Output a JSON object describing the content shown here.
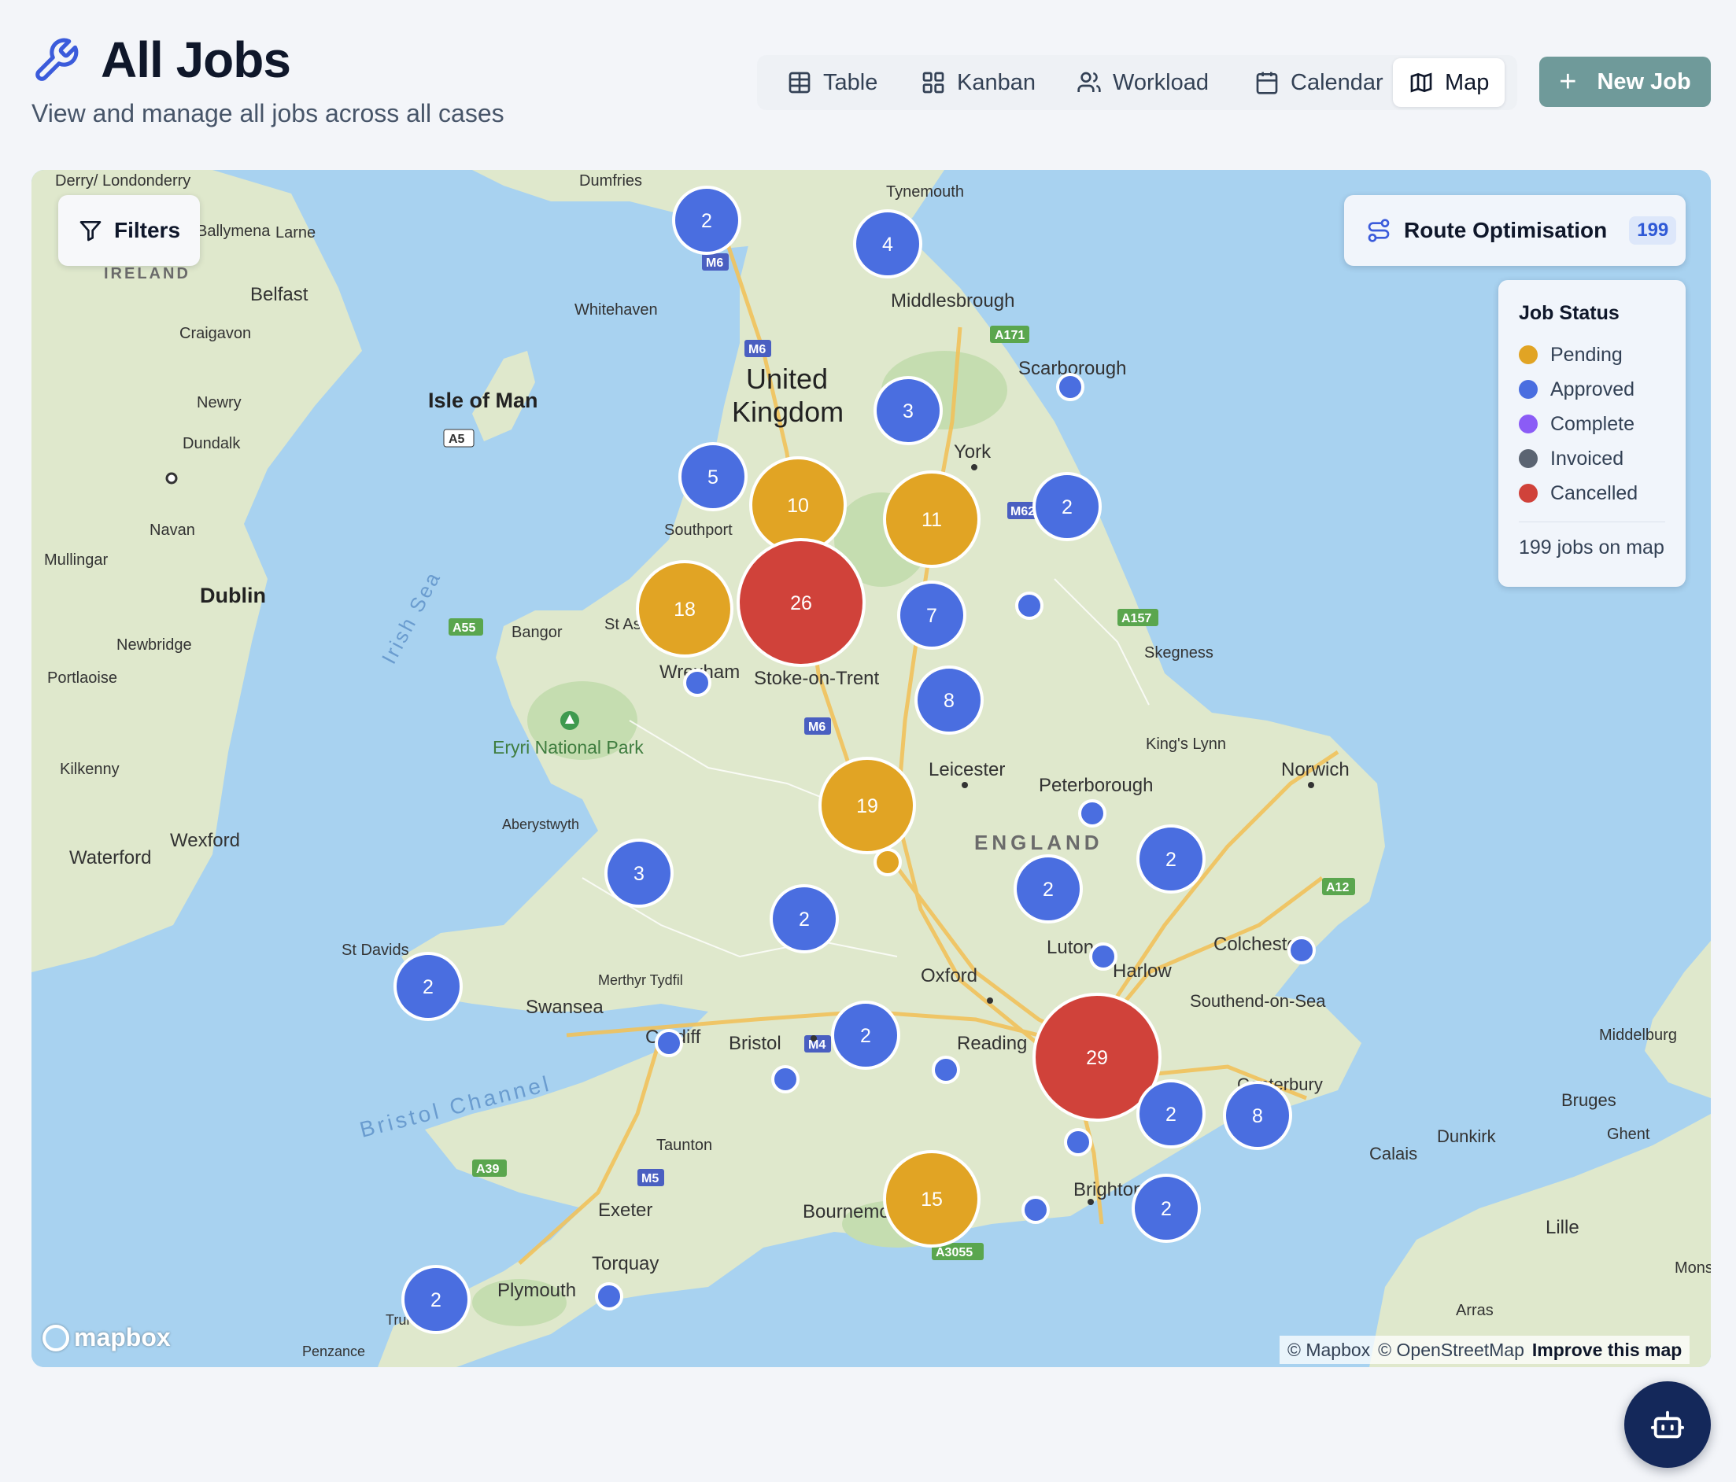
{
  "header": {
    "title": "All Jobs",
    "subtitle": "View and manage all jobs across all cases",
    "icon": "wrench-icon"
  },
  "view_tabs": [
    {
      "label": "Table",
      "icon": "table-icon"
    },
    {
      "label": "Kanban",
      "icon": "kanban-icon"
    },
    {
      "label": "Workload",
      "icon": "users-icon"
    },
    {
      "label": "Calendar",
      "icon": "calendar-icon"
    },
    {
      "label": "Map",
      "icon": "map-icon",
      "active": true
    }
  ],
  "new_job_label": "New Job",
  "map": {
    "filters_label": "Filters",
    "route_label": "Route Optimisation",
    "route_count": "199",
    "legend_title": "Job Status",
    "legend": [
      {
        "label": "Pending",
        "color": "#e1a424"
      },
      {
        "label": "Approved",
        "color": "#4a6ee0"
      },
      {
        "label": "Complete",
        "color": "#8b5cf6"
      },
      {
        "label": "Invoiced",
        "color": "#5b6472"
      },
      {
        "label": "Cancelled",
        "color": "#d0423a"
      }
    ],
    "jobs_on_map": "199 jobs on map",
    "attribution": {
      "mapbox": "© Mapbox",
      "osm": "© OpenStreetMap",
      "improve": "Improve this map"
    },
    "mapbox_logo": "mapbox",
    "place_labels": [
      "Derry/ Londonderry",
      "Dumfries",
      "Tynemouth",
      "Ballymena",
      "Larne",
      "IRELAND",
      "Belfast",
      "Middlesbrough",
      "Whitehaven",
      "Craigavon",
      "Scarborough",
      "United",
      "Kingdom",
      "Isle of Man",
      "Newry",
      "Dundalk",
      "York",
      "Southport",
      "Navan",
      "Mullingar",
      "Dublin",
      "Irish Sea",
      "Bangor",
      "St Asaph",
      "Skegness",
      "Newbridge",
      "Portlaoise",
      "Wrexham",
      "Stoke-on-Trent",
      "Eryri National Park",
      "King's Lynn",
      "Leicester",
      "Norwich",
      "Peterborough",
      "Kilkenny",
      "Aberystwyth",
      "ENGLAND",
      "Wexford",
      "Waterford",
      "Colchester",
      "Luton",
      "St Davids",
      "Harlow",
      "Oxford",
      "Merthyr Tydfil",
      "Southend-on-Sea",
      "Swansea",
      "Cardiff",
      "Bristol",
      "Reading",
      "Middelburg",
      "Bristol Channel",
      "Canterbury",
      "Bruges",
      "Dunkirk",
      "Ghent",
      "Calais",
      "Taunton",
      "Exeter",
      "Bournemouth",
      "Brighton",
      "Lille",
      "Torquay",
      "Plymouth",
      "Mons",
      "Arras",
      "Penzance",
      "Truro"
    ],
    "road_labels": [
      "M6",
      "M6",
      "A171",
      "A5",
      "M62",
      "A55",
      "A157",
      "M6",
      "A12",
      "M4",
      "M5",
      "A39",
      "A3055"
    ],
    "clusters": [
      {
        "count": "2",
        "status": "Approved"
      },
      {
        "count": "4",
        "status": "Approved"
      },
      {
        "count": "3",
        "status": "Approved"
      },
      {
        "count": "5",
        "status": "Approved"
      },
      {
        "count": "10",
        "status": "Pending"
      },
      {
        "count": "11",
        "status": "Pending"
      },
      {
        "count": "2",
        "status": "Approved"
      },
      {
        "count": "18",
        "status": "Pending"
      },
      {
        "count": "26",
        "status": "Cancelled"
      },
      {
        "count": "7",
        "status": "Approved"
      },
      {
        "count": "8",
        "status": "Approved"
      },
      {
        "count": "19",
        "status": "Pending"
      },
      {
        "count": "3",
        "status": "Approved"
      },
      {
        "count": "2",
        "status": "Approved"
      },
      {
        "count": "2",
        "status": "Approved"
      },
      {
        "count": "2",
        "status": "Approved"
      },
      {
        "count": "2",
        "status": "Approved"
      },
      {
        "count": "2",
        "status": "Approved"
      },
      {
        "count": "29",
        "status": "Cancelled"
      },
      {
        "count": "2",
        "status": "Approved"
      },
      {
        "count": "8",
        "status": "Approved"
      },
      {
        "count": "15",
        "status": "Pending"
      },
      {
        "count": "2",
        "status": "Approved"
      },
      {
        "count": "2",
        "status": "Approved"
      }
    ],
    "single_markers": 13
  },
  "assistant_icon": "robot-icon"
}
